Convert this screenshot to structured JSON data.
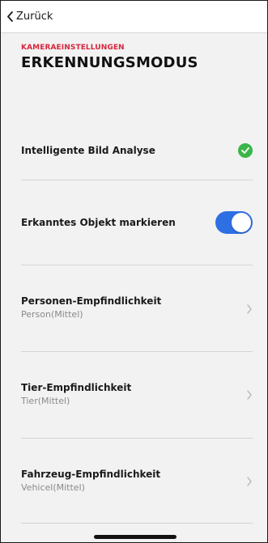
{
  "nav": {
    "back_label": "Zurück"
  },
  "header": {
    "section_label": "KAMERAEINSTELLUNGEN",
    "title": "ERKENNUNGSMODUS"
  },
  "items": [
    {
      "title": "Intelligente Bild Analyse",
      "control": "check-icon",
      "enabled": true
    },
    {
      "title": "Erkanntes Objekt markieren",
      "control": "toggle",
      "enabled": true
    },
    {
      "title": "Personen-Empfindlichkeit",
      "subtitle": "Person(Mittel)",
      "control": "chevron-right-icon"
    },
    {
      "title": "Tier-Empfindlichkeit",
      "subtitle": "Tier(Mittel)",
      "control": "chevron-right-icon"
    },
    {
      "title": "Fahrzeug-Empfindlichkeit",
      "subtitle": "Vehicel(Mittel)",
      "control": "chevron-right-icon"
    }
  ],
  "colors": {
    "accent_red": "#d7263d",
    "toggle_blue": "#2f6fe4",
    "check_green": "#3bb54a"
  }
}
